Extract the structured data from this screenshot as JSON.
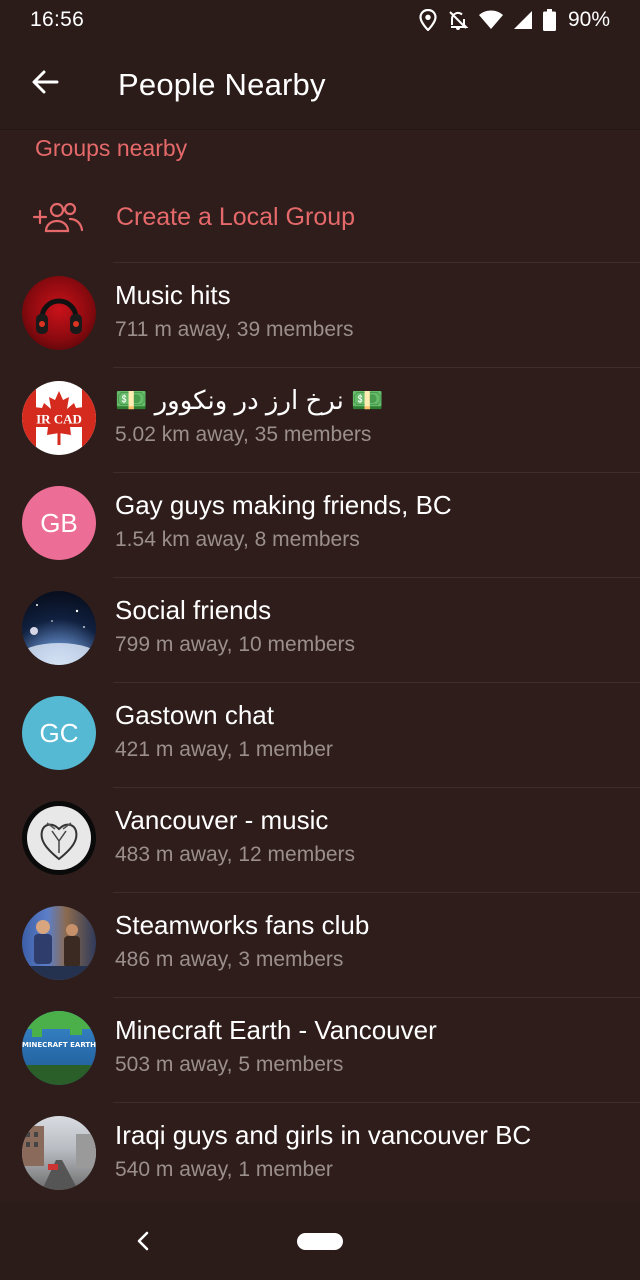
{
  "status_bar": {
    "time": "16:56",
    "battery": "90%",
    "icons": [
      "location-icon",
      "notifications-off-icon",
      "wifi-icon",
      "cell-signal-icon",
      "battery-icon"
    ]
  },
  "app_bar": {
    "title": "People Nearby",
    "back_icon": "arrow-left-icon"
  },
  "section": {
    "header": "Groups nearby"
  },
  "create_group": {
    "label": "Create a Local Group",
    "icon": "add-group-icon"
  },
  "groups": [
    {
      "name": "Music hits",
      "subtitle": "711 m away, 39 members",
      "avatar": "headphones-photo"
    },
    {
      "name": "💵 نرخ ارز در ونکوور 💵",
      "subtitle": "5.02 km away, 35 members",
      "avatar": "canada-flag-photo",
      "avatar_text": "IR CAD"
    },
    {
      "name": "Gay guys making friends, BC",
      "subtitle": "1.54 km away, 8 members",
      "avatar_initials": "GB",
      "avatar_color": "#ec6e96"
    },
    {
      "name": "Social friends",
      "subtitle": "799 m away, 10 members",
      "avatar": "space-photo"
    },
    {
      "name": "Gastown chat",
      "subtitle": "421 m away, 1 member",
      "avatar_initials": "GC",
      "avatar_color": "#55b9d3"
    },
    {
      "name": "Vancouver - music",
      "subtitle": "483 m away, 12 members",
      "avatar": "heart-sketch-photo"
    },
    {
      "name": "Steamworks fans club",
      "subtitle": "486 m away, 3 members",
      "avatar": "people-photo"
    },
    {
      "name": "Minecraft Earth - Vancouver",
      "subtitle": "503 m away, 5 members",
      "avatar": "minecraft-earth-logo",
      "avatar_text": "MINECRAFT EARTH"
    },
    {
      "name": "Iraqi guys and girls in vancouver BC",
      "subtitle": "540 m away, 1 member",
      "avatar": "street-photo"
    }
  ],
  "colors": {
    "background": "#2e1d1b",
    "accent": "#e5696a",
    "secondary_text": "#9b8f8d"
  }
}
